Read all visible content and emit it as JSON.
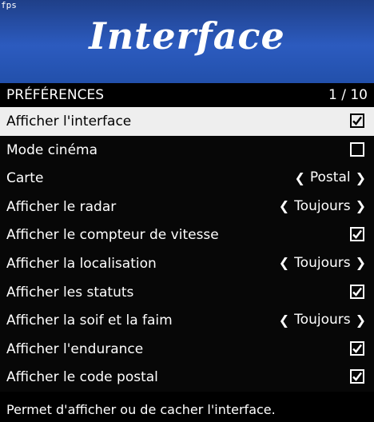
{
  "overlay": {
    "fps": "fps"
  },
  "banner": {
    "title": "Interface"
  },
  "header": {
    "title": "PRÉFÉRENCES",
    "counter": "1 / 10"
  },
  "menu": {
    "items": [
      {
        "label": "Afficher l'interface",
        "type": "checkbox",
        "checked": true,
        "selected": true
      },
      {
        "label": "Mode cinéma",
        "type": "checkbox",
        "checked": false
      },
      {
        "label": "Carte",
        "type": "list",
        "value": "Postal"
      },
      {
        "label": "Afficher le radar",
        "type": "list",
        "value": "Toujours"
      },
      {
        "label": "Afficher le compteur de vitesse",
        "type": "checkbox",
        "checked": true
      },
      {
        "label": "Afficher la localisation",
        "type": "list",
        "value": "Toujours"
      },
      {
        "label": "Afficher les statuts",
        "type": "checkbox",
        "checked": true
      },
      {
        "label": "Afficher la soif et la faim",
        "type": "list",
        "value": "Toujours"
      },
      {
        "label": "Afficher l'endurance",
        "type": "checkbox",
        "checked": true
      },
      {
        "label": "Afficher le code postal",
        "type": "checkbox",
        "checked": true
      }
    ]
  },
  "footer": {
    "description": "Permet d'afficher ou de cacher l'interface."
  },
  "icons": {
    "left": "chevron-left-icon",
    "right": "chevron-right-icon",
    "check": "checkmark-icon"
  }
}
